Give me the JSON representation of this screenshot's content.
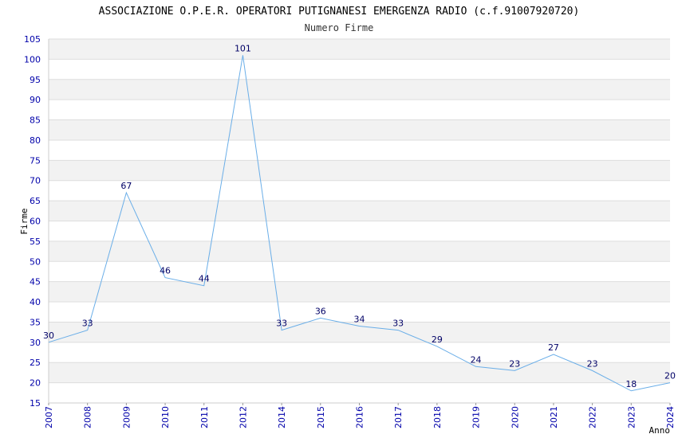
{
  "chart_data": {
    "type": "line",
    "title": "ASSOCIAZIONE O.P.E.R. OPERATORI PUTIGNANESI EMERGENZA RADIO (c.f.91007920720)",
    "subtitle": "Numero Firme",
    "xlabel": "Anno",
    "ylabel": "Firme",
    "categories": [
      "2007",
      "2008",
      "2009",
      "2010",
      "2011",
      "2012",
      "2014",
      "2015",
      "2016",
      "2017",
      "2018",
      "2019",
      "2020",
      "2021",
      "2022",
      "2023",
      "2024"
    ],
    "values": [
      30,
      33,
      67,
      46,
      44,
      101,
      33,
      36,
      34,
      33,
      29,
      24,
      23,
      27,
      23,
      18,
      20
    ],
    "ylim": [
      15,
      105
    ],
    "ystep": 5,
    "grid": true,
    "colors": {
      "line": "#6aaee8",
      "band": "#f2f2f2",
      "grid": "#dddddd",
      "tick": "#0000aa",
      "label": "#000066"
    }
  }
}
